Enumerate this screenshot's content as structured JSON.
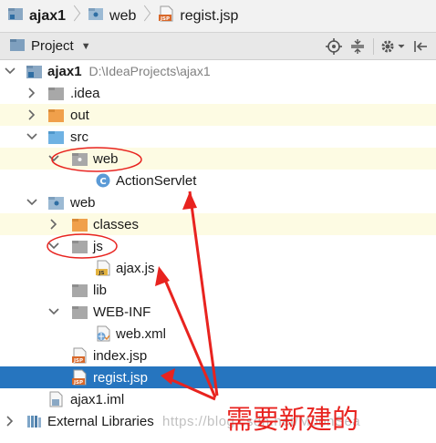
{
  "breadcrumb": {
    "items": [
      {
        "label": "ajax1",
        "icon": "module-folder-icon"
      },
      {
        "label": "web",
        "icon": "web-folder-icon"
      },
      {
        "label": "regist.jsp",
        "icon": "jsp-file-icon"
      }
    ]
  },
  "toolbar": {
    "title": "Project",
    "buttons": [
      "locate-icon",
      "collapse-all-icon",
      "settings-icon",
      "hide-panel-icon"
    ]
  },
  "tree": {
    "root": {
      "label": "ajax1",
      "path": "D:\\IdeaProjects\\ajax1"
    },
    "items": [
      {
        "label": ".idea"
      },
      {
        "label": "out"
      },
      {
        "label": "src"
      },
      {
        "label": "web"
      },
      {
        "label": "ActionServlet"
      },
      {
        "label": "web"
      },
      {
        "label": "classes"
      },
      {
        "label": "js"
      },
      {
        "label": "ajax.js"
      },
      {
        "label": "lib"
      },
      {
        "label": "WEB-INF"
      },
      {
        "label": "web.xml"
      },
      {
        "label": "index.jsp"
      },
      {
        "label": "regist.jsp"
      },
      {
        "label": "ajax1.iml"
      },
      {
        "label": "External Libraries"
      }
    ],
    "selected": "regist.jsp"
  },
  "annotation": {
    "text": "需要新建的",
    "color": "#e8231f"
  },
  "watermark": "https://blog.csdn.net/MoonSea",
  "colors": {
    "selection": "#2675bf",
    "highlight_row": "#fdfbe3",
    "folder_blue": "#8db7d8",
    "folder_orange": "#f0a04b",
    "annotation_red": "#e8231f"
  }
}
